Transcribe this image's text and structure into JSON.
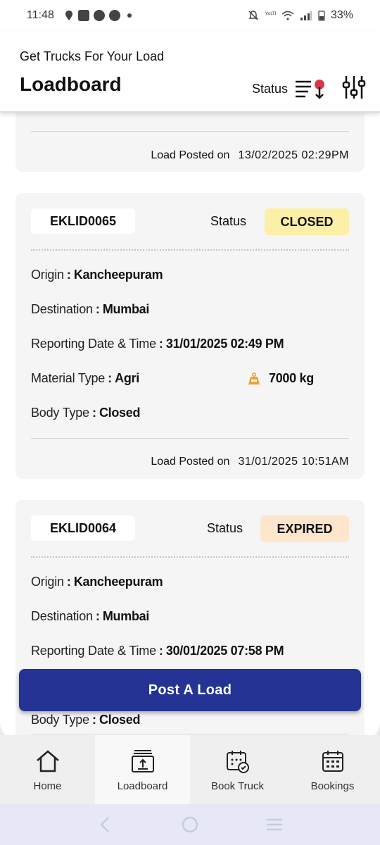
{
  "statusbar": {
    "time": "11:48",
    "battery": "33%"
  },
  "header": {
    "subtitle": "Get Trucks For Your Load",
    "title": "Loadboard",
    "status_label": "Status"
  },
  "partial_card": {
    "posted_label": "Load Posted on",
    "posted_date": "13/02/2025 02:29PM"
  },
  "loads": [
    {
      "id": "EKLID0065",
      "status_label": "Status",
      "status": "CLOSED",
      "status_color": "#fcf0a8",
      "origin_label": "Origin",
      "origin": "Kancheepuram",
      "destination_label": "Destination",
      "destination": "Mumbai",
      "reporting_label": "Reporting Date & Time",
      "reporting": "31/01/2025 02:49 PM",
      "material_label": "Material Type",
      "material": "Agri",
      "weight": "7000 kg",
      "body_label": "Body Type",
      "body": "Closed",
      "posted_label": "Load Posted on",
      "posted_date": "31/01/2025 10:51AM"
    },
    {
      "id": "EKLID0064",
      "status_label": "Status",
      "status": "EXPIRED",
      "status_color": "#fde6cc",
      "origin_label": "Origin",
      "origin": "Kancheepuram",
      "destination_label": "Destination",
      "destination": "Mumbai",
      "reporting_label": "Reporting Date & Time",
      "reporting": "30/01/2025 07:58 PM",
      "body_label": "Body Type",
      "body": "Closed"
    }
  ],
  "post_button": "Post A Load",
  "nav": [
    {
      "label": "Home",
      "icon": "home-icon"
    },
    {
      "label": "Loadboard",
      "icon": "loadboard-icon"
    },
    {
      "label": "Book Truck",
      "icon": "book-truck-icon"
    },
    {
      "label": "Bookings",
      "icon": "bookings-icon"
    }
  ],
  "colors": {
    "primary": "#253394",
    "accent_red": "#d63a4a",
    "weight_icon": "#f0a030"
  }
}
